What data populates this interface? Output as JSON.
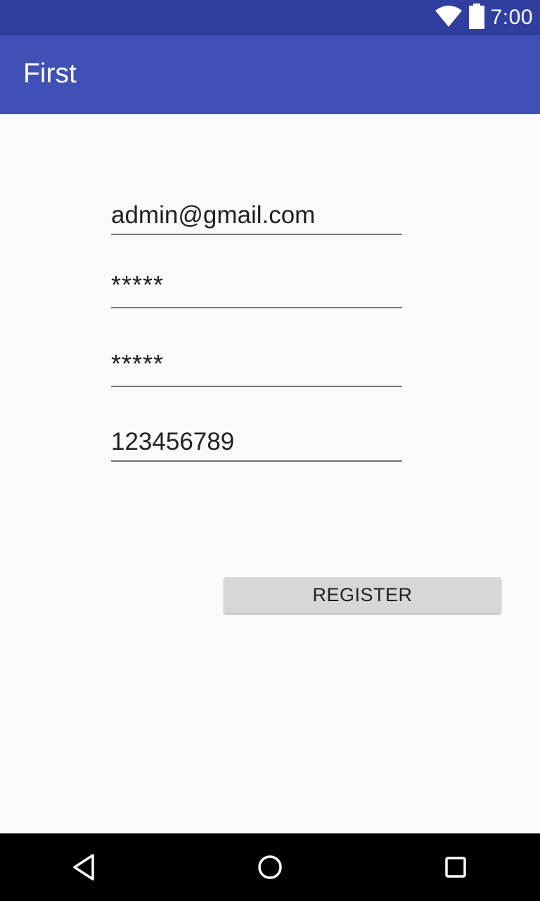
{
  "status_bar": {
    "time": "7:00",
    "icons": [
      "wifi-icon",
      "battery-icon"
    ]
  },
  "app_bar": {
    "title": "First"
  },
  "form": {
    "email": {
      "value": "admin@gmail.com"
    },
    "password": {
      "value": "*****"
    },
    "confirm_password": {
      "value": "*****"
    },
    "phone": {
      "value": "123456789"
    },
    "register_label": "REGISTER"
  },
  "nav_bar": {
    "icons": [
      "back-icon",
      "home-icon",
      "recents-icon"
    ]
  },
  "colors": {
    "primary": "#3f51b5",
    "primary_dark": "#303f9f",
    "background": "#fafafa",
    "button": "#d6d7d7"
  }
}
